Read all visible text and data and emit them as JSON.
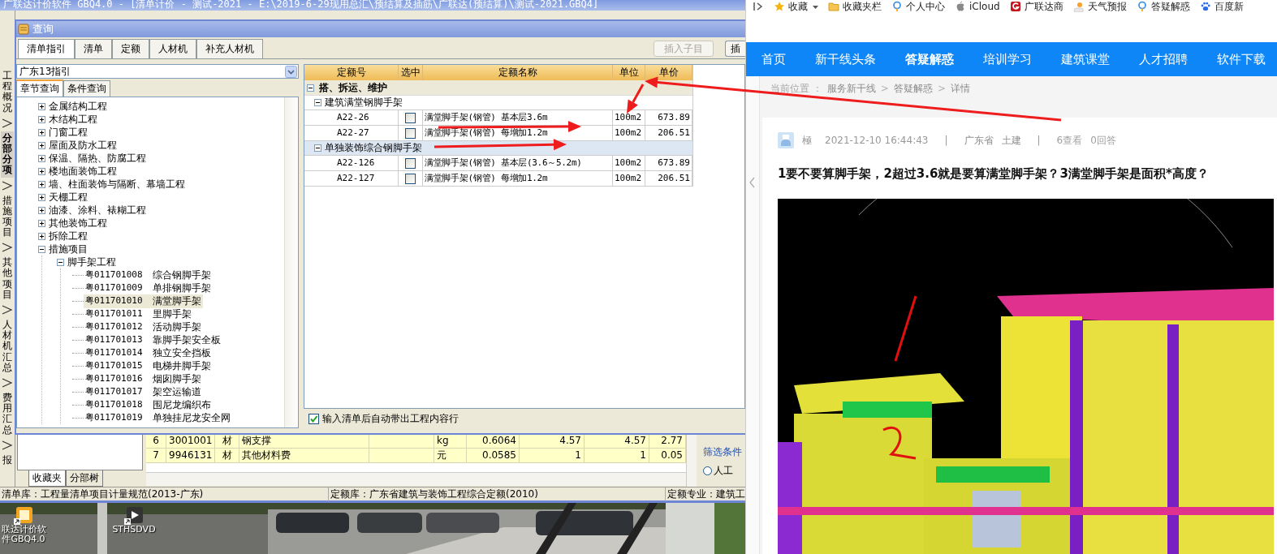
{
  "app": {
    "title": "广联达计价软件 GBQ4.0 - [清单计价 - 测试-2021 - E:\\2019-6-29现用总汇\\预结算及插筋\\广联达(预结算)\\测试-2021.GBQ4]",
    "nav_tabs": [
      {
        "label": "工程概况",
        "selected": false
      },
      {
        "label": "分部分项",
        "selected": true
      },
      {
        "label": "措施项目",
        "selected": false
      },
      {
        "label": "其他项目",
        "selected": false
      },
      {
        "label": "人材机汇总",
        "selected": false
      },
      {
        "label": "费用汇总",
        "selected": false
      },
      {
        "label": "报",
        "selected": false
      }
    ],
    "side_tabs": [
      {
        "label": "收藏夹",
        "selected": true
      },
      {
        "label": "分部树",
        "selected": false
      }
    ],
    "grid_rows": [
      {
        "cells": [
          "6",
          "3001001",
          "材",
          "钢支撑",
          "kg",
          "0.6064",
          "4.57",
          "4.57",
          "2.77"
        ]
      },
      {
        "cells": [
          "7",
          "9946131",
          "材",
          "其他材料费",
          "元",
          "0.0585",
          "1",
          "1",
          "0.05"
        ]
      }
    ],
    "filter": {
      "title": "筛选条件",
      "options": [
        {
          "label": "人工",
          "selected": false
        }
      ]
    },
    "status_bar": [
      "清单库：工程量清单项目计量规范(2013-广东)",
      "定额库：广东省建筑与装饰工程综合定额(2010)",
      "定额专业：建筑工"
    ]
  },
  "dialog": {
    "title": "查询",
    "tabs": [
      {
        "label": "清单指引",
        "selected": true
      },
      {
        "label": "清单",
        "selected": false
      },
      {
        "label": "定额",
        "selected": false
      },
      {
        "label": "人材机",
        "selected": false
      },
      {
        "label": "补充人材机",
        "selected": false
      }
    ],
    "insert_button": {
      "label": "插入子目",
      "disabled": true
    },
    "cut_button": "插",
    "guide_select": {
      "value": "广东13指引"
    },
    "query_tabs": [
      {
        "label": "章节查询",
        "selected": true
      },
      {
        "label": "条件查询",
        "selected": false
      }
    ],
    "tree": [
      {
        "label": "金属结构工程",
        "expanded": false
      },
      {
        "label": "木结构工程",
        "expanded": false
      },
      {
        "label": "门窗工程",
        "expanded": false
      },
      {
        "label": "屋面及防水工程",
        "expanded": false
      },
      {
        "label": "保温、隔热、防腐工程",
        "expanded": false
      },
      {
        "label": "楼地面装饰工程",
        "expanded": false
      },
      {
        "label": "墙、柱面装饰与隔断、幕墙工程",
        "expanded": false
      },
      {
        "label": "天棚工程",
        "expanded": false
      },
      {
        "label": "油漆、涂料、裱糊工程",
        "expanded": false
      },
      {
        "label": "其他装饰工程",
        "expanded": false
      },
      {
        "label": "拆除工程",
        "expanded": false
      },
      {
        "label": "措施项目",
        "expanded": true,
        "children": [
          {
            "label": "脚手架工程",
            "expanded": true,
            "children": [
              {
                "code": "粤011701008",
                "label": "综合钢脚手架",
                "selected": false
              },
              {
                "code": "粤011701009",
                "label": "单排钢脚手架",
                "selected": false
              },
              {
                "code": "粤011701010",
                "label": "满堂脚手架",
                "selected": true
              },
              {
                "code": "粤011701011",
                "label": "里脚手架",
                "selected": false
              },
              {
                "code": "粤011701012",
                "label": "活动脚手架",
                "selected": false
              },
              {
                "code": "粤011701013",
                "label": "靠脚手架安全板",
                "selected": false
              },
              {
                "code": "粤011701014",
                "label": "独立安全挡板",
                "selected": false
              },
              {
                "code": "粤011701015",
                "label": "电梯井脚手架",
                "selected": false
              },
              {
                "code": "粤011701016",
                "label": "烟囱脚手架",
                "selected": false
              },
              {
                "code": "粤011701017",
                "label": "架空运输道",
                "selected": false
              },
              {
                "code": "粤011701018",
                "label": "围尼龙编织布",
                "selected": false
              },
              {
                "code": "粤011701019",
                "label": "单独挂尼龙安全网",
                "selected": false
              }
            ]
          }
        ]
      }
    ],
    "table": {
      "columns": [
        "定额号",
        "选中",
        "定额名称",
        "单位",
        "单价"
      ],
      "groups": [
        {
          "label": "搭、拆运、维护",
          "expanded": true,
          "children": [
            {
              "label": "建筑满堂钢脚手架",
              "expanded": true,
              "selected": false,
              "rows": [
                {
                  "code": "A22-26",
                  "checked": false,
                  "name": "满堂脚手架(钢管) 基本层3.6m",
                  "unit": "100m2",
                  "price": "673.89"
                },
                {
                  "code": "A22-27",
                  "checked": false,
                  "name": "满堂脚手架(钢管) 每增加1.2m",
                  "unit": "100m2",
                  "price": "206.51"
                }
              ]
            },
            {
              "label": "单独装饰综合钢脚手架",
              "expanded": true,
              "selected": true,
              "rows": [
                {
                  "code": "A22-126",
                  "checked": false,
                  "name": "满堂脚手架(钢管) 基本层(3.6～5.2m)",
                  "unit": "100m2",
                  "price": "673.89"
                },
                {
                  "code": "A22-127",
                  "checked": false,
                  "name": "满堂脚手架(钢管) 每增加1.2m",
                  "unit": "100m2",
                  "price": "206.51"
                }
              ]
            }
          ]
        }
      ]
    },
    "auto_fill": {
      "label": "输入清单后自动带出工程内容行",
      "checked": true
    }
  },
  "desktop": {
    "icons": [
      {
        "label": "联达计价软件GBQ4.0",
        "kind": "app"
      },
      {
        "label": "STHSDVD",
        "kind": "media"
      }
    ]
  },
  "browser": {
    "bookmarks": [
      {
        "label": "收藏",
        "kind": "star"
      },
      {
        "label": "收藏夹栏",
        "kind": "folder"
      },
      {
        "label": "个人中心",
        "kind": "bulb"
      },
      {
        "label": "iCloud",
        "kind": "apple"
      },
      {
        "label": "广联达商",
        "kind": "g"
      },
      {
        "label": "天气预报",
        "kind": "weather"
      },
      {
        "label": "答疑解惑",
        "kind": "bulb"
      },
      {
        "label": "百度新",
        "kind": "paw"
      }
    ],
    "nav": [
      {
        "label": "首页",
        "selected": false
      },
      {
        "label": "新干线头条",
        "selected": false
      },
      {
        "label": "答疑解惑",
        "selected": true
      },
      {
        "label": "培训学习",
        "selected": false
      },
      {
        "label": "建筑课堂",
        "selected": false
      },
      {
        "label": "人才招聘",
        "selected": false
      },
      {
        "label": "软件下载",
        "selected": false
      }
    ],
    "breadcrumb": [
      {
        "kind": "label",
        "text": "当前位置 ："
      },
      {
        "kind": "link",
        "text": "服务新干线"
      },
      {
        "kind": "sep",
        "text": ">"
      },
      {
        "kind": "link",
        "text": "答疑解惑"
      },
      {
        "kind": "sep",
        "text": ">"
      },
      {
        "kind": "link",
        "text": "详情"
      }
    ],
    "post": {
      "meta": [
        {
          "kind": "author",
          "text": "極"
        },
        {
          "kind": "time",
          "text": "2021-12-10 16:44:43"
        },
        {
          "kind": "sep",
          "text": "|"
        },
        {
          "kind": "tag",
          "text": "广东省"
        },
        {
          "kind": "tag",
          "text": "土建"
        },
        {
          "kind": "sep",
          "text": "|"
        },
        {
          "kind": "stat",
          "text": "6查看"
        },
        {
          "kind": "stat",
          "text": "0回答"
        }
      ],
      "question": "1要不要算脚手架，2超过3.6就是要算满堂脚手架？3满堂脚手架是面积*高度？"
    }
  }
}
